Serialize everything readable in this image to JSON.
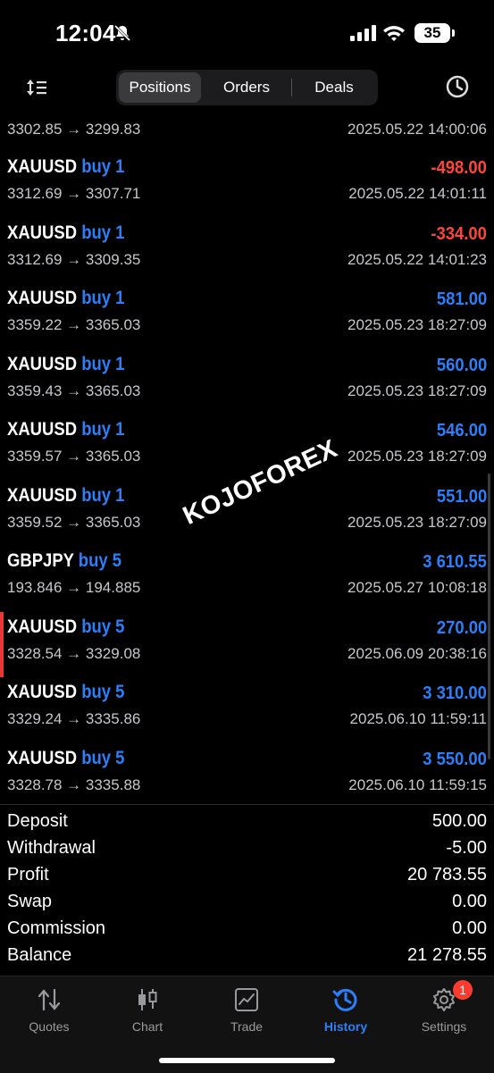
{
  "status_bar": {
    "time": "12:04",
    "battery": "35"
  },
  "toolbar": {
    "segments": [
      {
        "label": "Positions",
        "active": true
      },
      {
        "label": "Orders",
        "active": false
      },
      {
        "label": "Deals",
        "active": false
      }
    ]
  },
  "deals": {
    "first": {
      "prices": "3302.85 → 3299.83",
      "date": "2025.05.22 14:00:06"
    },
    "rows": [
      {
        "symbol": "XAUUSD",
        "direction": "buy 1",
        "prices": "3312.69 → 3307.71",
        "profit": "-498.00",
        "date": "2025.05.22 14:01:11"
      },
      {
        "symbol": "XAUUSD",
        "direction": "buy 1",
        "prices": "3312.69 → 3309.35",
        "profit": "-334.00",
        "date": "2025.05.22 14:01:23"
      },
      {
        "symbol": "XAUUSD",
        "direction": "buy 1",
        "prices": "3359.22 → 3365.03",
        "profit": "581.00",
        "date": "2025.05.23 18:27:09"
      },
      {
        "symbol": "XAUUSD",
        "direction": "buy 1",
        "prices": "3359.43 → 3365.03",
        "profit": "560.00",
        "date": "2025.05.23 18:27:09"
      },
      {
        "symbol": "XAUUSD",
        "direction": "buy 1",
        "prices": "3359.57 → 3365.03",
        "profit": "546.00",
        "date": "2025.05.23 18:27:09"
      },
      {
        "symbol": "XAUUSD",
        "direction": "buy 1",
        "prices": "3359.52 → 3365.03",
        "profit": "551.00",
        "date": "2025.05.23 18:27:09"
      },
      {
        "symbol": "GBPJPY",
        "direction": "buy 5",
        "prices": "193.846 → 194.885",
        "profit": "3 610.55",
        "date": "2025.05.27 10:08:18"
      },
      {
        "symbol": "XAUUSD",
        "direction": "buy 5",
        "prices": "3328.54 → 3329.08",
        "profit": "270.00",
        "date": "2025.06.09 20:38:16"
      },
      {
        "symbol": "XAUUSD",
        "direction": "buy 5",
        "prices": "3329.24 → 3335.86",
        "profit": "3 310.00",
        "date": "2025.06.10 11:59:11"
      },
      {
        "symbol": "XAUUSD",
        "direction": "buy 5",
        "prices": "3328.78 → 3335.88",
        "profit": "3 550.00",
        "date": "2025.06.10 11:59:15"
      }
    ]
  },
  "watermark": "KOJOFOREX",
  "summary": {
    "rows": [
      {
        "label": "Deposit",
        "value": "500.00"
      },
      {
        "label": "Withdrawal",
        "value": "-5.00"
      },
      {
        "label": "Profit",
        "value": "20 783.55"
      },
      {
        "label": "Swap",
        "value": "0.00"
      },
      {
        "label": "Commission",
        "value": "0.00"
      },
      {
        "label": "Balance",
        "value": "21 278.55"
      }
    ]
  },
  "tabbar": {
    "tabs": [
      {
        "label": "Quotes",
        "icon": "quotes-icon"
      },
      {
        "label": "Chart",
        "icon": "chart-icon"
      },
      {
        "label": "Trade",
        "icon": "trade-icon"
      },
      {
        "label": "History",
        "icon": "history-icon",
        "active": true
      },
      {
        "label": "Settings",
        "icon": "gear-icon",
        "badge": "1"
      }
    ]
  },
  "colors": {
    "accent": "#2d7ff9",
    "negative": "#ff453a",
    "badge": "#ff3b30",
    "marker": "#e53935"
  }
}
